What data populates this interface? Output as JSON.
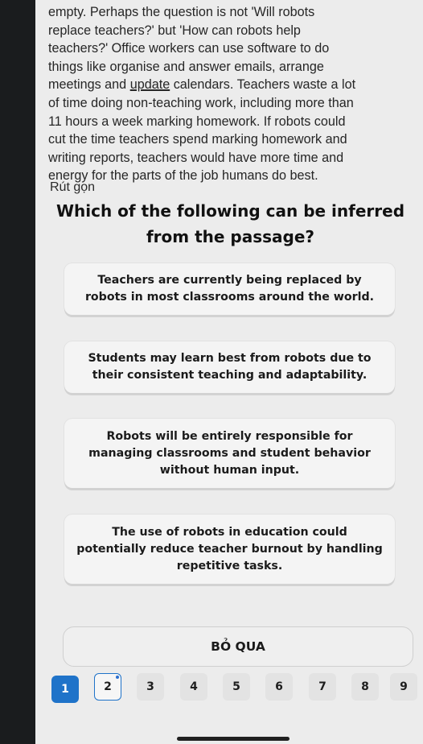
{
  "passage": {
    "lines": [
      "empty. Perhaps the question is not 'Will robots",
      "replace teachers?' but 'How can robots help",
      "teachers?' Office workers can use software to do",
      "things like organise and answer emails, arrange"
    ],
    "line5_before": "meetings and ",
    "line5_underlined": "update",
    "line5_after": " calendars. Teachers waste a lot",
    "lines_after": [
      "of time doing non-teaching work, including more than",
      "11 hours a week marking homework. If robots could",
      "cut the time teachers spend marking homework and",
      "writing reports, teachers would have more time and",
      "energy for the parts of the job humans do best."
    ]
  },
  "collapse_label": "Rút gọn",
  "question": "Which of the following can be inferred from the passage?",
  "options": [
    "Teachers are currently being replaced by robots in most classrooms around the world.",
    "Students may learn best from robots due to their consistent teaching and adaptability.",
    "Robots will be entirely responsible for managing classrooms and student behavior without human input.",
    "The use of robots in education could potentially reduce teacher burnout by handling repetitive tasks."
  ],
  "skip_label": "BỎ QUA",
  "pages": [
    "1",
    "2",
    "3",
    "4",
    "5",
    "6",
    "7",
    "8",
    "9"
  ],
  "current_page": "1",
  "colors": {
    "accent": "#1f73c9",
    "background": "#ececec"
  }
}
